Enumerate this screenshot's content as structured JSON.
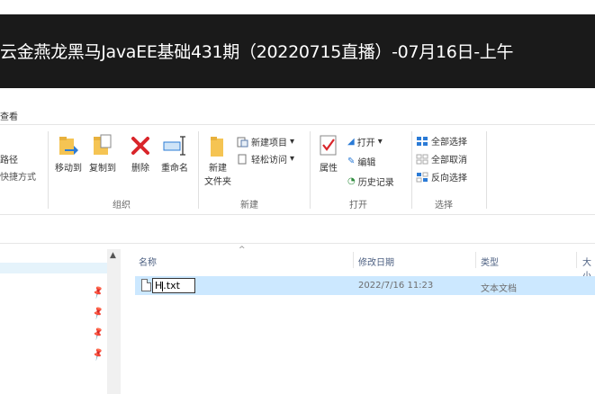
{
  "video_title": "云金燕龙黑马JavaEE基础431期（20220715直播）-07月16日-上午",
  "ribbon": {
    "view_tab": "查看",
    "clipboard_partial": {
      "path": "路径",
      "shortcut": "快捷方式"
    },
    "organize": {
      "label": "组织",
      "move_to": "移动到",
      "copy_to": "复制到",
      "delete": "删除",
      "rename": "重命名"
    },
    "new": {
      "label": "新建",
      "new_item": "新建项目",
      "easy_access": "轻松访问",
      "new_folder_line1": "新建",
      "new_folder_line2": "文件夹"
    },
    "open": {
      "label": "打开",
      "properties": "属性",
      "open": "打开",
      "edit": "编辑",
      "history": "历史记录"
    },
    "select": {
      "label": "选择",
      "select_all": "全部选择",
      "select_none": "全部取消",
      "invert": "反向选择"
    }
  },
  "file_list": {
    "headers": {
      "name": "名称",
      "modified": "修改日期",
      "type": "类型",
      "size": "大小"
    },
    "rows": [
      {
        "name_value": "H.txt",
        "name_before_caret": "H",
        "name_after_caret": ".txt",
        "modified": "2022/7/16 11:23",
        "type": "文本文档"
      }
    ]
  },
  "colors": {
    "title_bg": "#1a1a1a",
    "selection": "#cce8ff",
    "accent": "#0078d7"
  }
}
